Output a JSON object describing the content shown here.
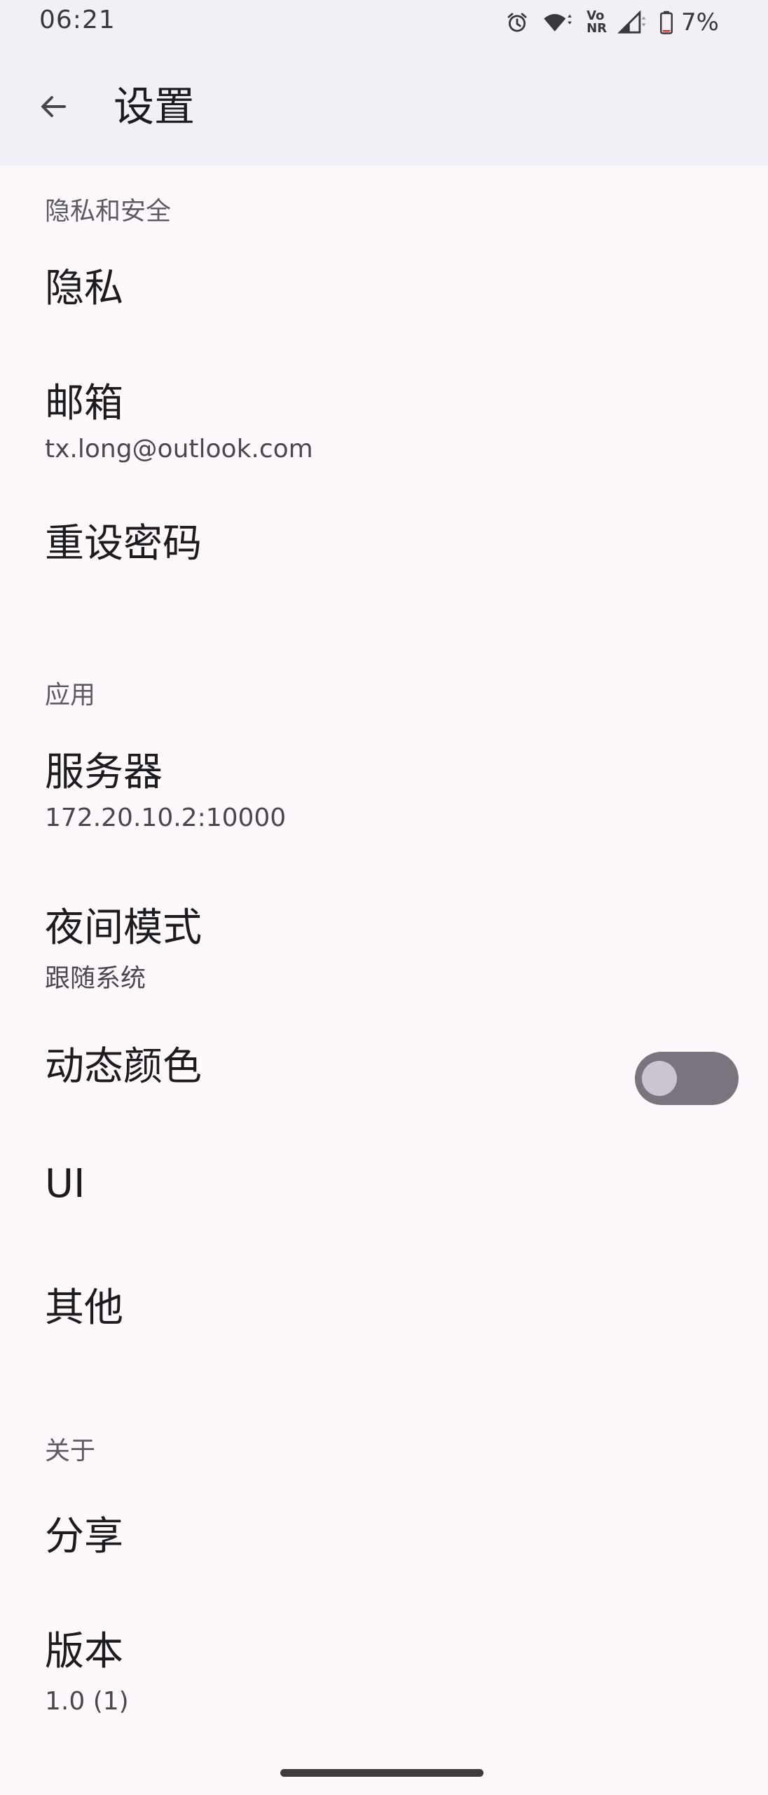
{
  "status_bar": {
    "time": "06:21",
    "battery": "7%",
    "icons": [
      "alarm-icon",
      "wifi-icon",
      "vonr-icon",
      "signal-icon",
      "battery-icon"
    ],
    "vonr_top": "Vo",
    "vonr_bottom": "NR"
  },
  "app_bar": {
    "back_icon": "arrow-back-icon",
    "title": "设置"
  },
  "sections": {
    "privacy": {
      "header": "隐私和安全",
      "privacy_title": "隐私",
      "email_title": "邮箱",
      "email_value": "tx.long@outlook.com",
      "reset_password_title": "重设密码"
    },
    "app": {
      "header": "应用",
      "server_title": "服务器",
      "server_value": "172.20.10.2:10000",
      "night_mode_title": "夜间模式",
      "night_mode_value": "跟随系统",
      "dynamic_color_title": "动态颜色",
      "dynamic_color_enabled": false,
      "ui_title": "UI",
      "other_title": "其他"
    },
    "about": {
      "header": "关于",
      "share_title": "分享",
      "version_title": "版本",
      "version_value": "1.0 (1)"
    }
  },
  "colors": {
    "background": "#fdf8fc",
    "app_bar": "#f3eff6",
    "switch_track_off": "#79747e",
    "switch_thumb_off": "#ccc4d0"
  }
}
